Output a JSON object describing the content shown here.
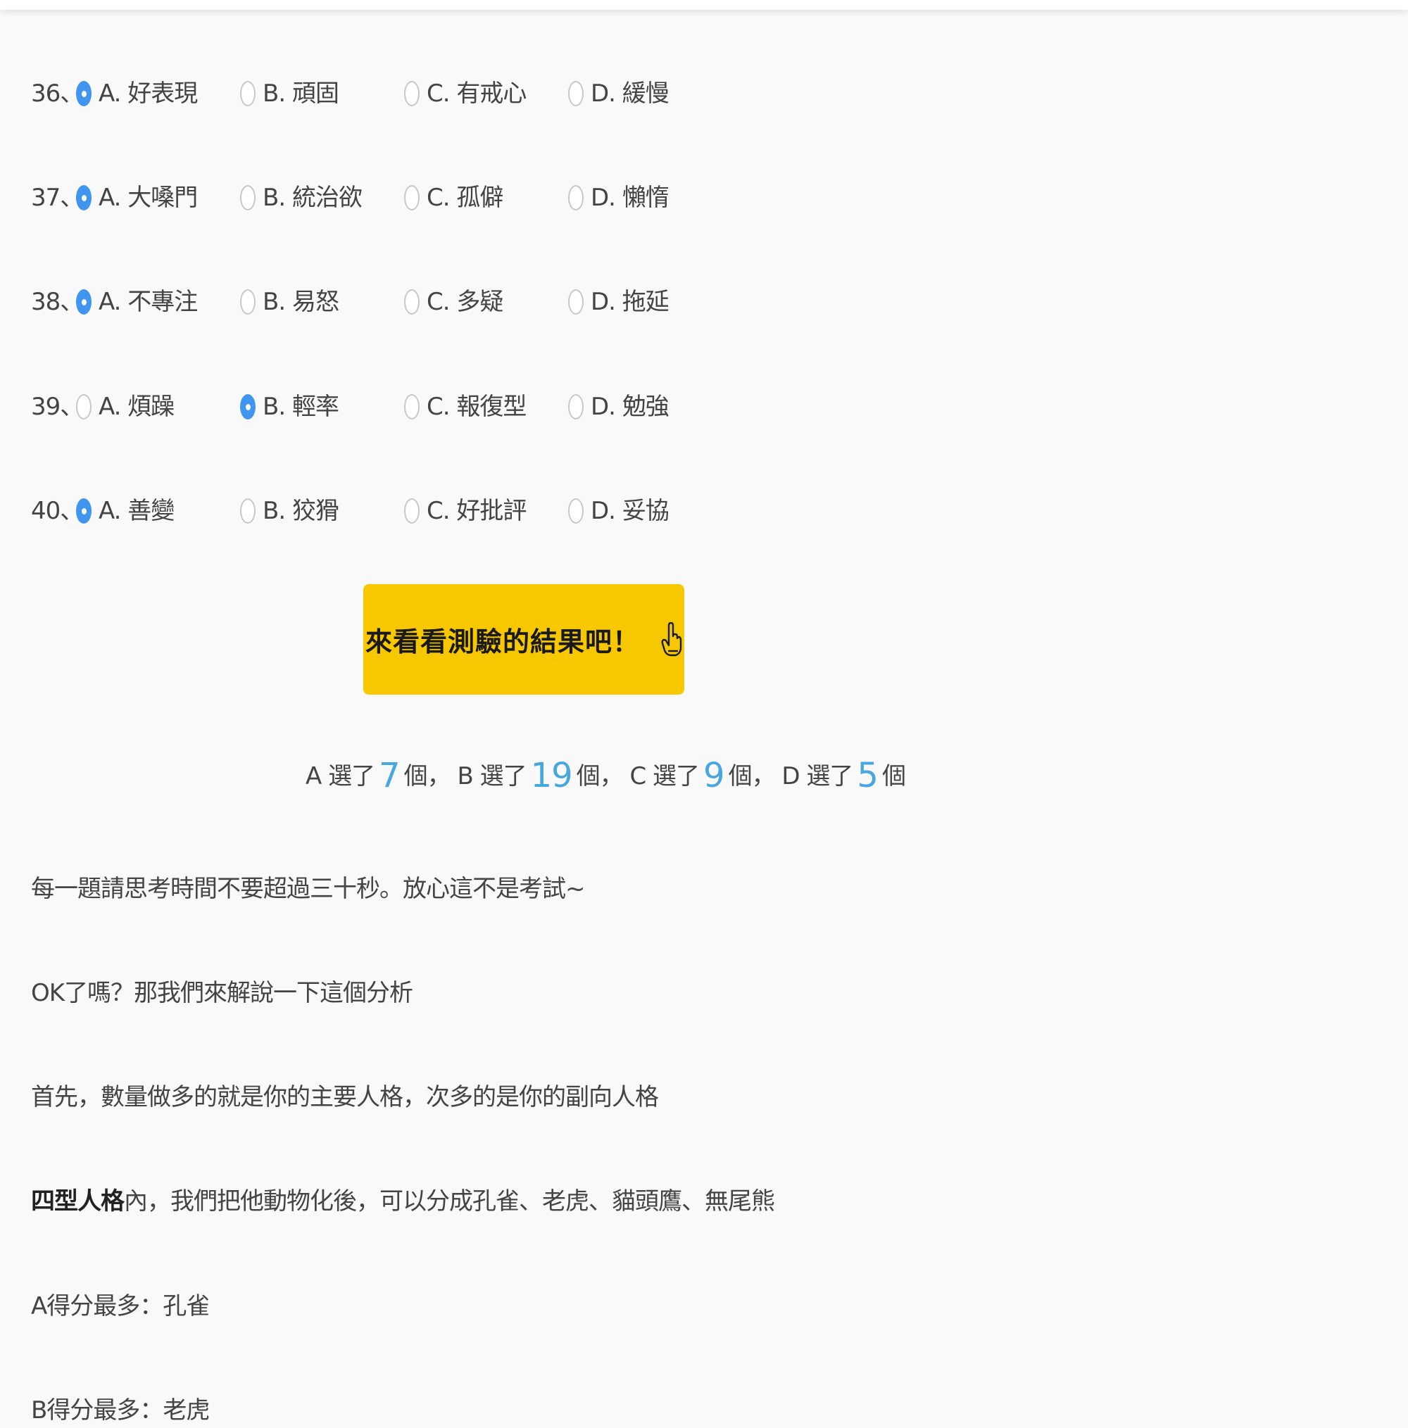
{
  "questions": [
    {
      "num": "36、",
      "options": [
        {
          "label": "A. 好表現",
          "checked": true
        },
        {
          "label": "B. 頑固",
          "checked": false
        },
        {
          "label": "C. 有戒心",
          "checked": false
        },
        {
          "label": "D. 緩慢",
          "checked": false
        }
      ]
    },
    {
      "num": "37、",
      "options": [
        {
          "label": "A. 大嗓門",
          "checked": true
        },
        {
          "label": "B. 統治欲",
          "checked": false
        },
        {
          "label": "C. 孤僻",
          "checked": false
        },
        {
          "label": "D. 懶惰",
          "checked": false
        }
      ]
    },
    {
      "num": "38、",
      "options": [
        {
          "label": "A. 不專注",
          "checked": true
        },
        {
          "label": "B. 易怒",
          "checked": false
        },
        {
          "label": "C. 多疑",
          "checked": false
        },
        {
          "label": "D. 拖延",
          "checked": false
        }
      ]
    },
    {
      "num": "39、",
      "options": [
        {
          "label": "A. 煩躁",
          "checked": false
        },
        {
          "label": "B. 輕率",
          "checked": true
        },
        {
          "label": "C. 報復型",
          "checked": false
        },
        {
          "label": "D. 勉強",
          "checked": false
        }
      ]
    },
    {
      "num": "40、",
      "options": [
        {
          "label": "A. 善變",
          "checked": true
        },
        {
          "label": "B. 狡猾",
          "checked": false
        },
        {
          "label": "C. 好批評",
          "checked": false
        },
        {
          "label": "D. 妥協",
          "checked": false
        }
      ]
    }
  ],
  "result_button": {
    "label": "來看看測驗的結果吧！",
    "icon": "pointing-hand-icon",
    "color": "#f7c800"
  },
  "tally": {
    "a_prefix": "A 選了",
    "a_count": "7",
    "a_suffix": "個，",
    "b_prefix": "B 選了",
    "b_count": "19",
    "b_suffix": "個，",
    "c_prefix": "C 選了",
    "c_count": "9",
    "c_suffix": "個，",
    "d_prefix": "D 選了",
    "d_count": "5",
    "d_suffix": "個",
    "count_color": "#48a6e0"
  },
  "article": {
    "p1": "每一題請思考時間不要超過三十秒。放心這不是考試~",
    "p2": "OK了嗎？那我們來解說一下這個分析",
    "p3": "首先，數量做多的就是你的主要人格，次多的是你的副向人格",
    "p4_bold": "四型人格",
    "p4_rest": "內，我們把他動物化後，可以分成孔雀、老虎、貓頭鷹、無尾熊",
    "p5": "A得分最多：孔雀",
    "p6": "B得分最多：老虎"
  },
  "colors": {
    "radio_checked": "#3f95f0",
    "background": "#f9f9f9"
  }
}
